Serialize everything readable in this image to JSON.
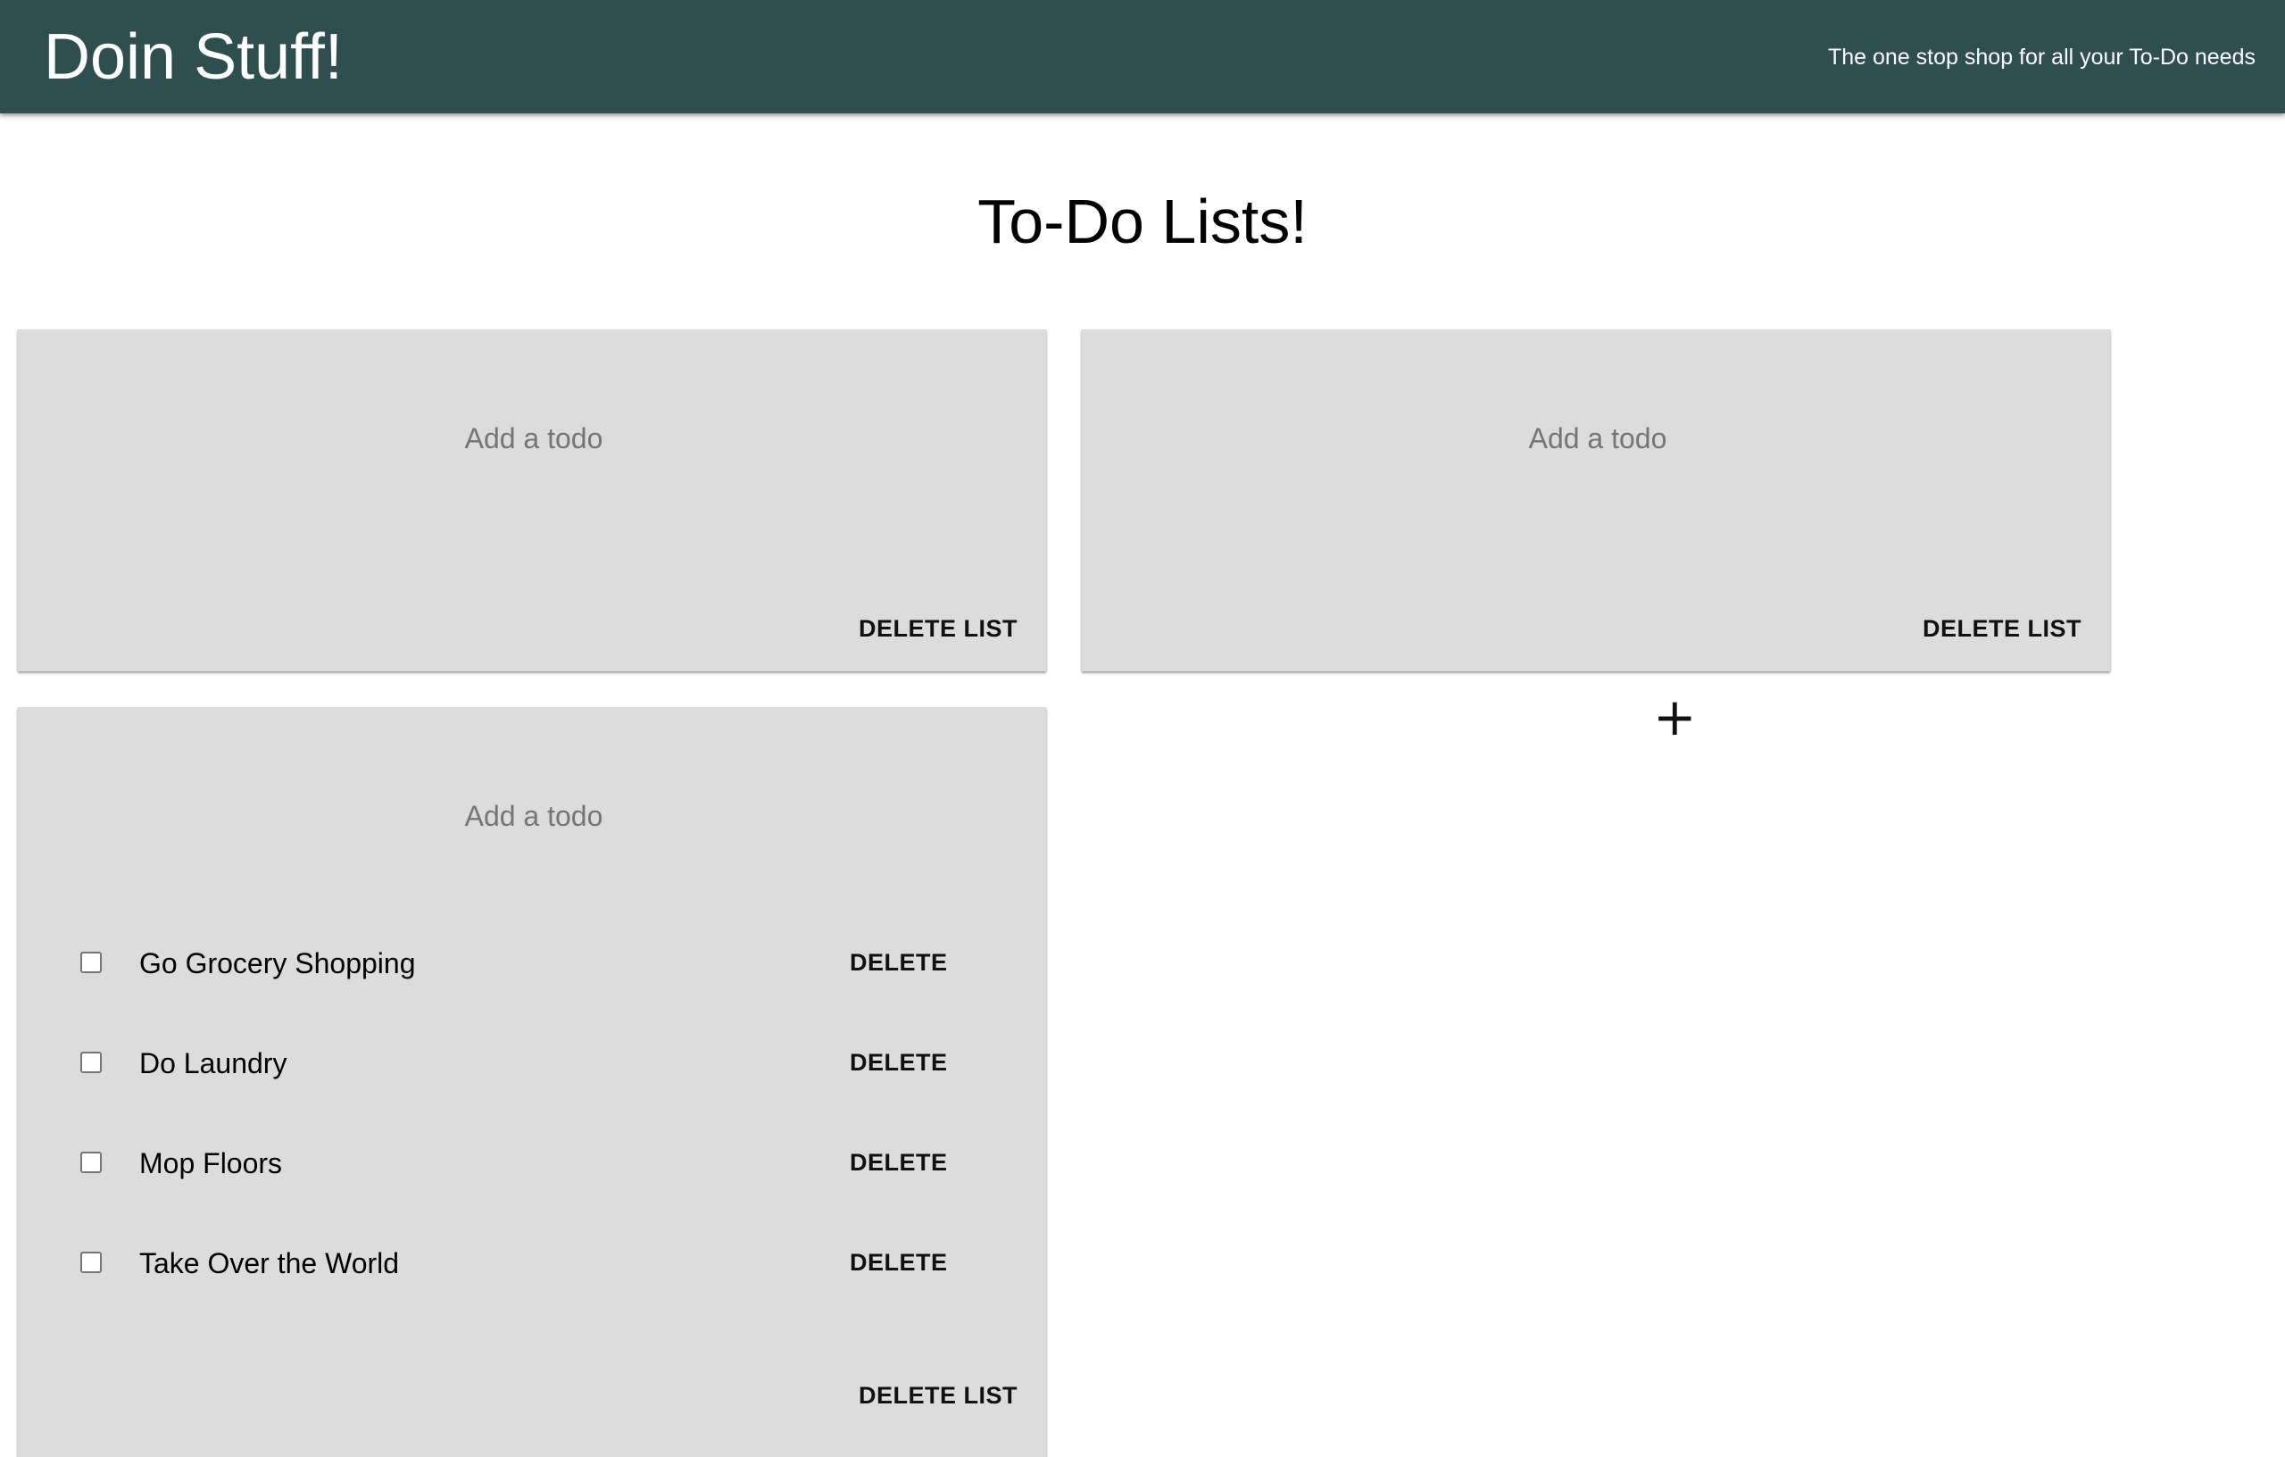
{
  "header": {
    "title": "Doin Stuff!",
    "tagline": "The one stop shop for all your To-Do needs"
  },
  "page": {
    "heading": "To-Do Lists!"
  },
  "lists": [
    {
      "input_placeholder": "Add a todo",
      "delete_list_label": "DELETE LIST",
      "todos": []
    },
    {
      "input_placeholder": "Add a todo",
      "delete_list_label": "DELETE LIST",
      "todos": []
    },
    {
      "input_placeholder": "Add a todo",
      "delete_list_label": "DELETE LIST",
      "todos": [
        {
          "label": "Go Grocery Shopping",
          "checked": false,
          "delete_label": "DELETE"
        },
        {
          "label": "Do Laundry",
          "checked": false,
          "delete_label": "DELETE"
        },
        {
          "label": "Mop Floors",
          "checked": false,
          "delete_label": "DELETE"
        },
        {
          "label": "Take Over the World",
          "checked": false,
          "delete_label": "DELETE"
        }
      ]
    }
  ],
  "add_list_button": {
    "label": "+",
    "icon": "plus-icon"
  },
  "colors": {
    "appbar": "#2f4f4f",
    "card_background": "#dcdcdc",
    "page_background": "#ffffff"
  }
}
